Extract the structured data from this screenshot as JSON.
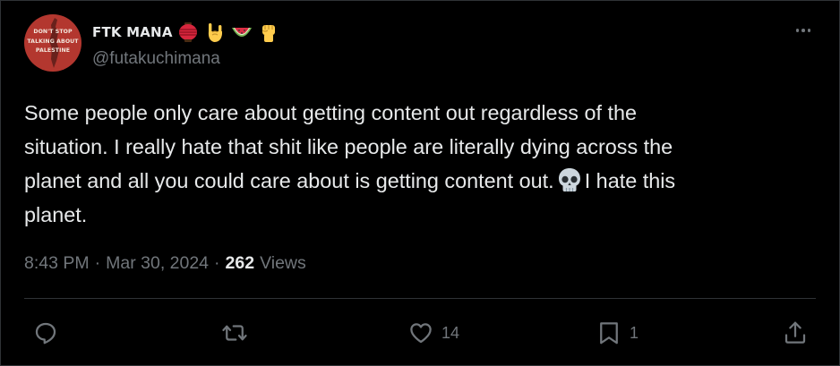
{
  "post": {
    "author": {
      "display_name": "FTK MANA",
      "name_emojis": [
        "red-paper-lantern",
        "sign-of-horns",
        "watermelon",
        "raised-fist"
      ],
      "handle": "@futakuchimana",
      "avatar_text": [
        "DON'T STOP",
        "TALKING ABOUT",
        "PALESTINE"
      ]
    },
    "text_lines": {
      "line1": "Some people only care about getting content out regardless of the",
      "line2": "situation. I really hate that shit like people are literally dying across the",
      "line3_before": "planet and all you could care about is getting content out.",
      "line3_after": "I hate this",
      "line4": "planet."
    },
    "time": "8:43 PM",
    "separator": "·",
    "date": "Mar 30, 2024",
    "views_count": "262",
    "views_label": "Views"
  },
  "actions": {
    "reply_icon": "reply-icon",
    "repost_icon": "repost-icon",
    "like_icon": "heart-icon",
    "like_count": "14",
    "bookmark_icon": "bookmark-icon",
    "bookmark_count": "1",
    "share_icon": "share-icon"
  },
  "colors": {
    "background": "#000000",
    "text_primary": "#e7e9ea",
    "text_secondary": "#71767b",
    "divider": "#2f3336",
    "avatar_bg": "#b3372f"
  }
}
